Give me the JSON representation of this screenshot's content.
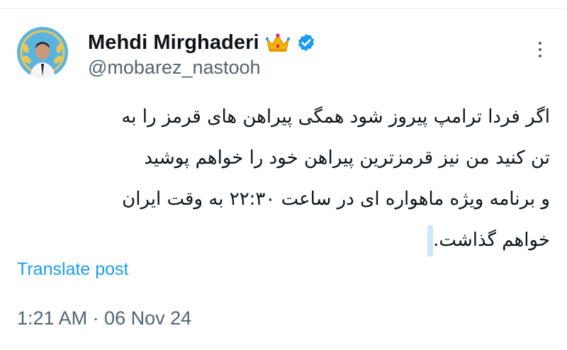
{
  "author": {
    "display_name": "Mehdi Mirghaderi",
    "handle": "@mobarez_nastooh",
    "name_emoji": "crown-icon",
    "verified_badge": "verified-icon"
  },
  "tweet": {
    "lines": [
      "اگر فردا ترامپ پیروز شود همگی پیراهن های قرمز را به",
      "تن کنید من نیز قرمزترین پیراهن خود را خواهم پوشید",
      "و برنامه ویژه ماهواره ای در ساعت ۲۲:۳۰ به وقت ایران",
      "خواهم گذاشت."
    ]
  },
  "actions": {
    "translate_label": "Translate post",
    "more_icon": "more-vertical-icon"
  },
  "meta": {
    "timestamp": "1:21 AM · 06 Nov 24"
  },
  "colors": {
    "text_primary": "#0f1419",
    "text_secondary": "#536471",
    "link": "#1d9bf0",
    "verified": "#1d9bf0",
    "crown": "#f4b400"
  }
}
